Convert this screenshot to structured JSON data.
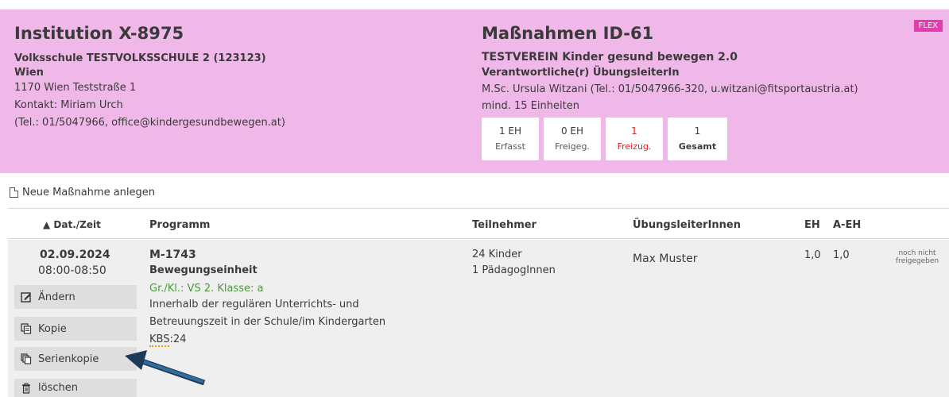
{
  "institution": {
    "title": "Institution X-8975",
    "school": "Volksschule TESTVOLKSSCHULE 2 (123123)",
    "city": "Wien",
    "address": "1170 Wien Teststraße 1",
    "contact": "Kontakt: Miriam Urch",
    "contact_details": "(Tel.: 01/5047966, office@kindergesundbewegen.at)"
  },
  "measure": {
    "title": "Maßnahmen ID-61",
    "association": "TESTVEREIN Kinder gesund bewegen 2.0",
    "responsible_label": "Verantwortliche(r) ÜbungsleiterIn",
    "responsible": "M.Sc. Ursula Witzani (Tel.: 01/5047966-320, u.witzani@fitsportaustria.at)",
    "min_units": "mind. 15 Einheiten",
    "badge": "FLEX",
    "stats": [
      {
        "value": "1 EH",
        "label": "Erfasst"
      },
      {
        "value": "0 EH",
        "label": "Freigeg."
      },
      {
        "value": "1",
        "label": "Freizug."
      },
      {
        "value": "1",
        "label": "Gesamt"
      }
    ],
    "colors": {
      "header_bg": "#f0b8e8",
      "badge_bg": "#e53ab0",
      "alert": "#e02020",
      "accent_green": "#4a9a3a"
    }
  },
  "new_link": "Neue Maßnahme anlegen",
  "table": {
    "headers": {
      "date": "▲ Dat./Zeit",
      "program": "Programm",
      "participants": "Teilnehmer",
      "trainers": "ÜbungsleiterInnen",
      "eh": "EH",
      "aeh": "A-EH"
    },
    "row": {
      "date": "02.09.2024",
      "time": "08:00-08:50",
      "code": "M-1743",
      "type": "Bewegungseinheit",
      "group": "Gr./Kl.: VS 2. Klasse: a",
      "desc1": "Innerhalb der regulären Unterrichts- und",
      "desc2": "Betreuungszeit in der Schule/im Kindergarten",
      "kbs_label": "KBS",
      "kbs_value": ":24",
      "participants1": "24 Kinder",
      "participants2": "1 PädagogInnen",
      "trainer": "Max Muster",
      "eh": "1,0",
      "aeh": "1,0",
      "status1": "noch nicht",
      "status2": "freigegeben"
    },
    "actions": [
      {
        "label": "Ändern",
        "icon": "edit-icon"
      },
      {
        "label": "Kopie",
        "icon": "copy-icon"
      },
      {
        "label": "Serienkopie",
        "icon": "series-copy-icon"
      },
      {
        "label": "löschen",
        "icon": "trash-icon"
      }
    ]
  }
}
